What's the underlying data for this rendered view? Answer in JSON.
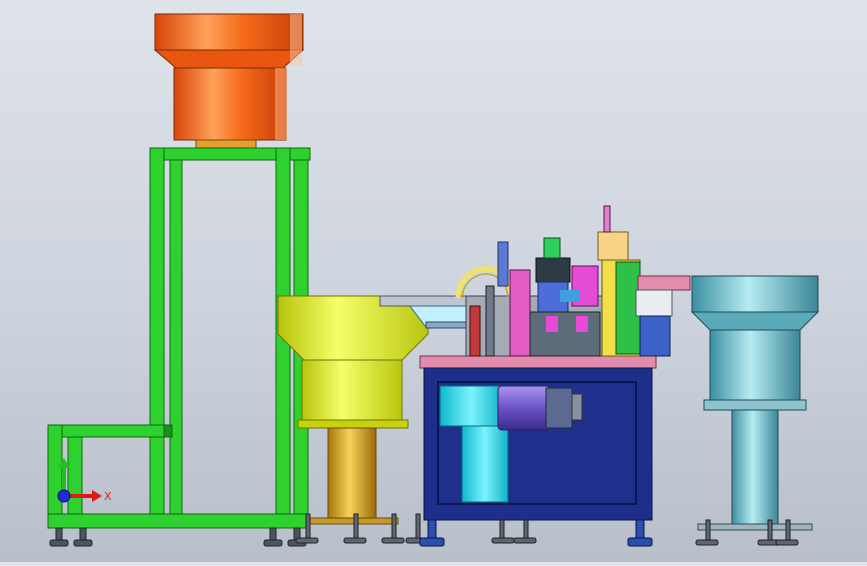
{
  "viewport": {
    "background_top": "#dfe3ea",
    "background_bottom": "#b9bfca"
  },
  "triad": {
    "x_axis_label": "X",
    "x_axis_color": "#e01818",
    "y_axis_color": "#22c022",
    "z_axis_color": "#1c2fd6"
  },
  "components": {
    "orange_feeder_color": "#f05a12",
    "green_frame_color": "#2ed12e",
    "yellow_feeder_color": "#d8e21a",
    "gold_column_color": "#d6a41a",
    "blue_table_color": "#1d2f8a",
    "cyan_cylinder_color": "#19d7e8",
    "purple_motor_color": "#7d64d8",
    "teal_feeder_color": "#62b6c6"
  }
}
